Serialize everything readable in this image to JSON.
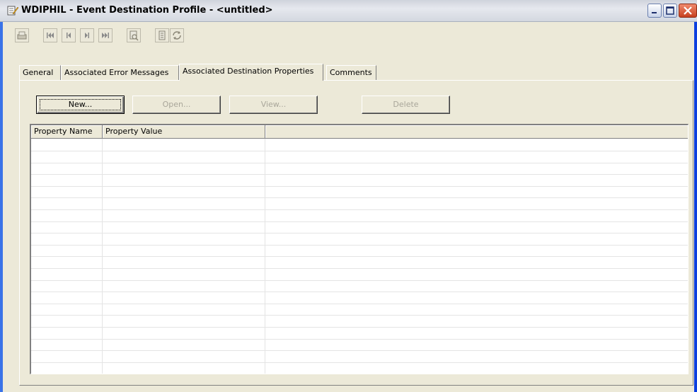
{
  "window": {
    "title": "WDIPHIL - Event Destination Profile - <untitled>"
  },
  "toolbar": {
    "icons": [
      "print-setup-icon",
      "first-record-icon",
      "previous-record-icon",
      "next-record-icon",
      "last-record-icon",
      "find-icon",
      "form-icon",
      "refresh-icon"
    ]
  },
  "tabs": [
    {
      "label": "General",
      "active": false
    },
    {
      "label": "Associated Error Messages",
      "active": false
    },
    {
      "label": "Associated Destination Properties",
      "active": true
    },
    {
      "label": "Comments",
      "active": false
    }
  ],
  "buttons": {
    "new": "New...",
    "open": "Open...",
    "view": "View...",
    "delete": "Delete"
  },
  "grid": {
    "columns": [
      "Property Name",
      "Property Value",
      ""
    ],
    "rows": []
  },
  "colors": {
    "window_frame": "#0054e3",
    "dialog_bg": "#ece9d8",
    "close_button": "#c7401f"
  }
}
